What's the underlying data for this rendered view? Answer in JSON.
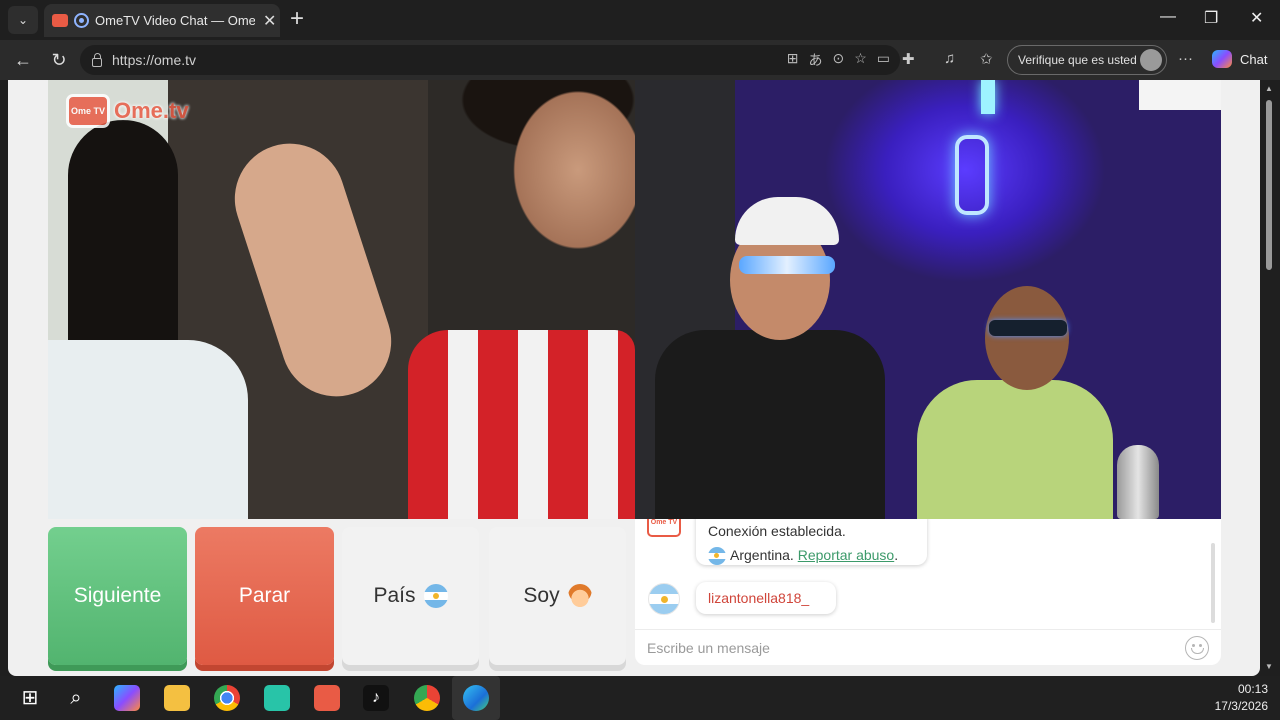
{
  "browser": {
    "tab_title": "OmeTV Video Chat — Omegle",
    "url": "https://ome.tv",
    "profile_label": "Verifique que es usted",
    "chat_label": "Chat"
  },
  "page": {
    "logo_badge": "Ome TV",
    "logo_text": "Ome.tv",
    "buttons": {
      "next": "Siguiente",
      "stop": "Parar",
      "country": "País",
      "me": "Soy"
    },
    "chat": {
      "system_badge": "Ome TV",
      "connection_msg": "Conexión establecida.",
      "country_name": "Argentina.",
      "report_link": "Reportar abuso",
      "report_suffix": ".",
      "partner_name": "lizantonella818_",
      "input_placeholder": "Escribe un mensaje"
    }
  },
  "taskbar": {
    "time": "00:13",
    "date": "17/3/2026"
  },
  "colors": {
    "next": "#5bbf78",
    "stop": "#e4634b",
    "brand": "#e95b45",
    "link": "#3c9a6a"
  }
}
